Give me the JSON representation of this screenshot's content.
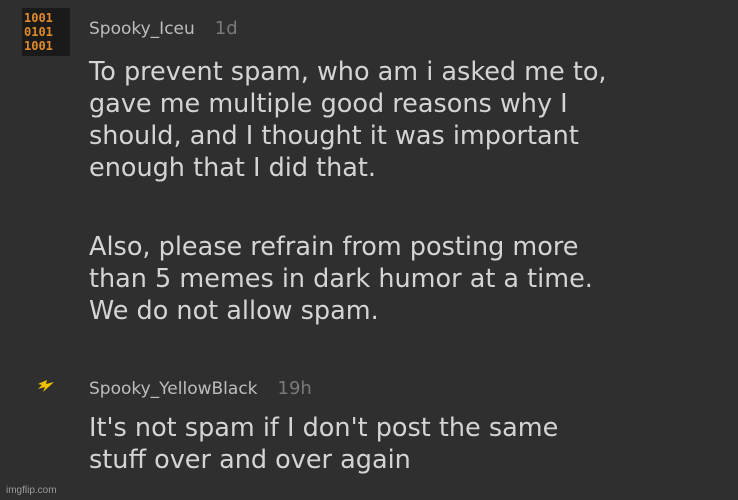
{
  "comments": [
    {
      "username": "Spooky_Iceu",
      "timestamp": "1d",
      "avatar_icon": "binary-digits-icon",
      "paragraphs": [
        [
          "To prevent spam, who am i asked me to,",
          "gave me multiple good reasons why I",
          "should, and I thought it was important",
          "enough that I did that."
        ],
        [
          "Also, please refrain from posting more",
          "than 5 memes in dark humor at a time.",
          "We do not allow spam."
        ]
      ]
    },
    {
      "username": "Spooky_YellowBlack",
      "timestamp": "19h",
      "avatar_icon": "lightning-bolt-icon",
      "paragraphs": [
        [
          "It's not spam if I don't post the same",
          "stuff over and over again"
        ]
      ]
    }
  ],
  "colors": {
    "background": "#2f2f2f",
    "text": "#d4d4d4",
    "username": "#bdbdbd",
    "timestamp": "#7a7a7a",
    "avatar_orange": "#e08a2a",
    "bolt_yellow": "#f2c200"
  },
  "watermark": "imgflip.com"
}
